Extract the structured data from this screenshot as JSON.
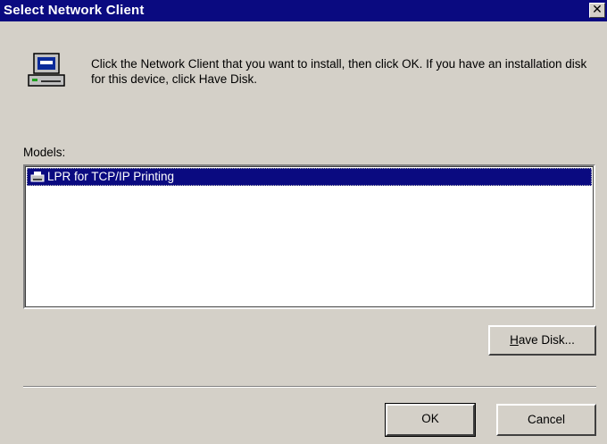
{
  "dialog": {
    "title": "Select Network Client",
    "close_glyph": "✕",
    "icon": "network-client-computer-icon",
    "instruction": "Click the Network Client that you want to install, then click OK. If you have an installation disk for this device, click Have Disk."
  },
  "models": {
    "label": "Models:",
    "items": [
      {
        "label": "LPR for TCP/IP Printing",
        "icon": "printer-icon",
        "selected": true
      }
    ]
  },
  "buttons": {
    "have_disk_underlined": "H",
    "have_disk_rest": "ave Disk...",
    "ok": "OK",
    "cancel": "Cancel"
  },
  "colors": {
    "titlebar": "#0a0a80",
    "selection": "#0a0a80",
    "face": "#d4d0c8"
  }
}
